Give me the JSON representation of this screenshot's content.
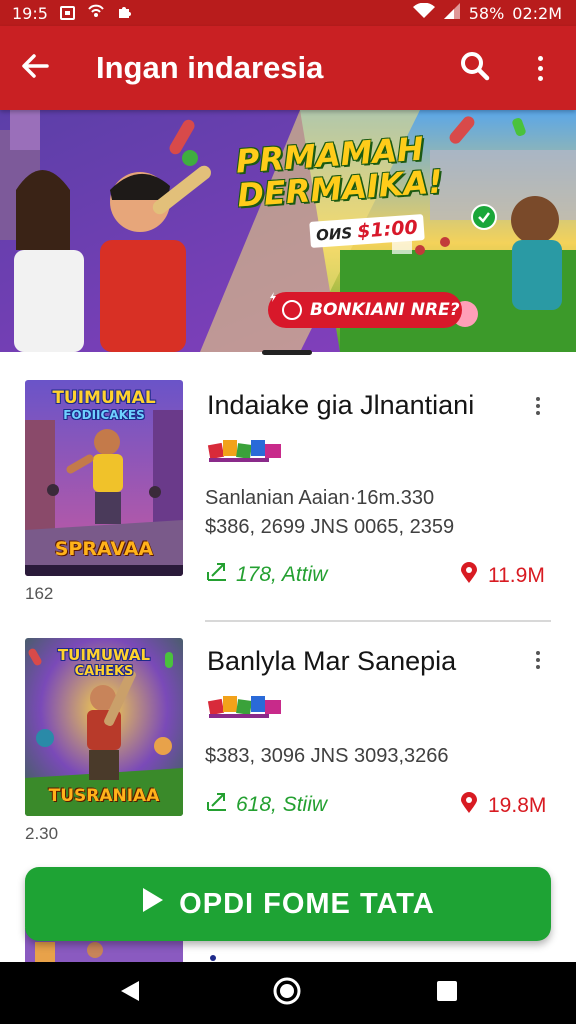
{
  "status_bar": {
    "time": "19:5",
    "battery": "58%",
    "clock_right": "02:2M",
    "icons": [
      "image-icon",
      "hotspot-icon",
      "puzzle-icon",
      "wifi-icon",
      "signal-icon"
    ]
  },
  "app_bar": {
    "title": "Ingan indaresia",
    "icons": [
      "back-arrow-icon",
      "search-icon",
      "more-vert-icon"
    ]
  },
  "banner": {
    "title_line1": "PRMAMAH",
    "title_line2": "DERMAIKA!",
    "price_prefix": "ОИS",
    "price": "$1:00",
    "cta_label": "BONKIANI NRE?",
    "colors": {
      "primary_red": "#c92023",
      "accent_green": "#1ea334",
      "gold": "#ffcc1a"
    }
  },
  "games": [
    {
      "thumb_title_top": "TUIMUMAL",
      "thumb_title_mid": "FODIICAKES",
      "thumb_title_bottom": "SPRAVAA",
      "caption": "162",
      "title": "Indaiake gia Jlnantiani",
      "brand_logo_icon": "game-brand-logo-icon",
      "desc_line1": "Sanlanian Aaian·16m.330",
      "desc_line2": "$386, 2699 JNS 0065, 2359",
      "stat_left": "178, Attiw",
      "stat_right": "11.9M"
    },
    {
      "thumb_title_top": "TUIMUWAL",
      "thumb_title_mid": "CAHEKS",
      "thumb_title_bottom": "TUSRANIAA",
      "caption": "2.30",
      "title": "Banlyla Mar Sanepia",
      "brand_logo_icon": "game-brand-logo-icon",
      "desc_line1": "$383, 3096 JNS 3093,3266",
      "stat_left": "618, Stiiw",
      "stat_right": "19.8M"
    }
  ],
  "open_button": {
    "label": "OPDI FOME TATA",
    "icon": "play-icon"
  },
  "nav_bar": {
    "icons": [
      "nav-back-icon",
      "nav-home-icon",
      "nav-recents-icon"
    ]
  }
}
